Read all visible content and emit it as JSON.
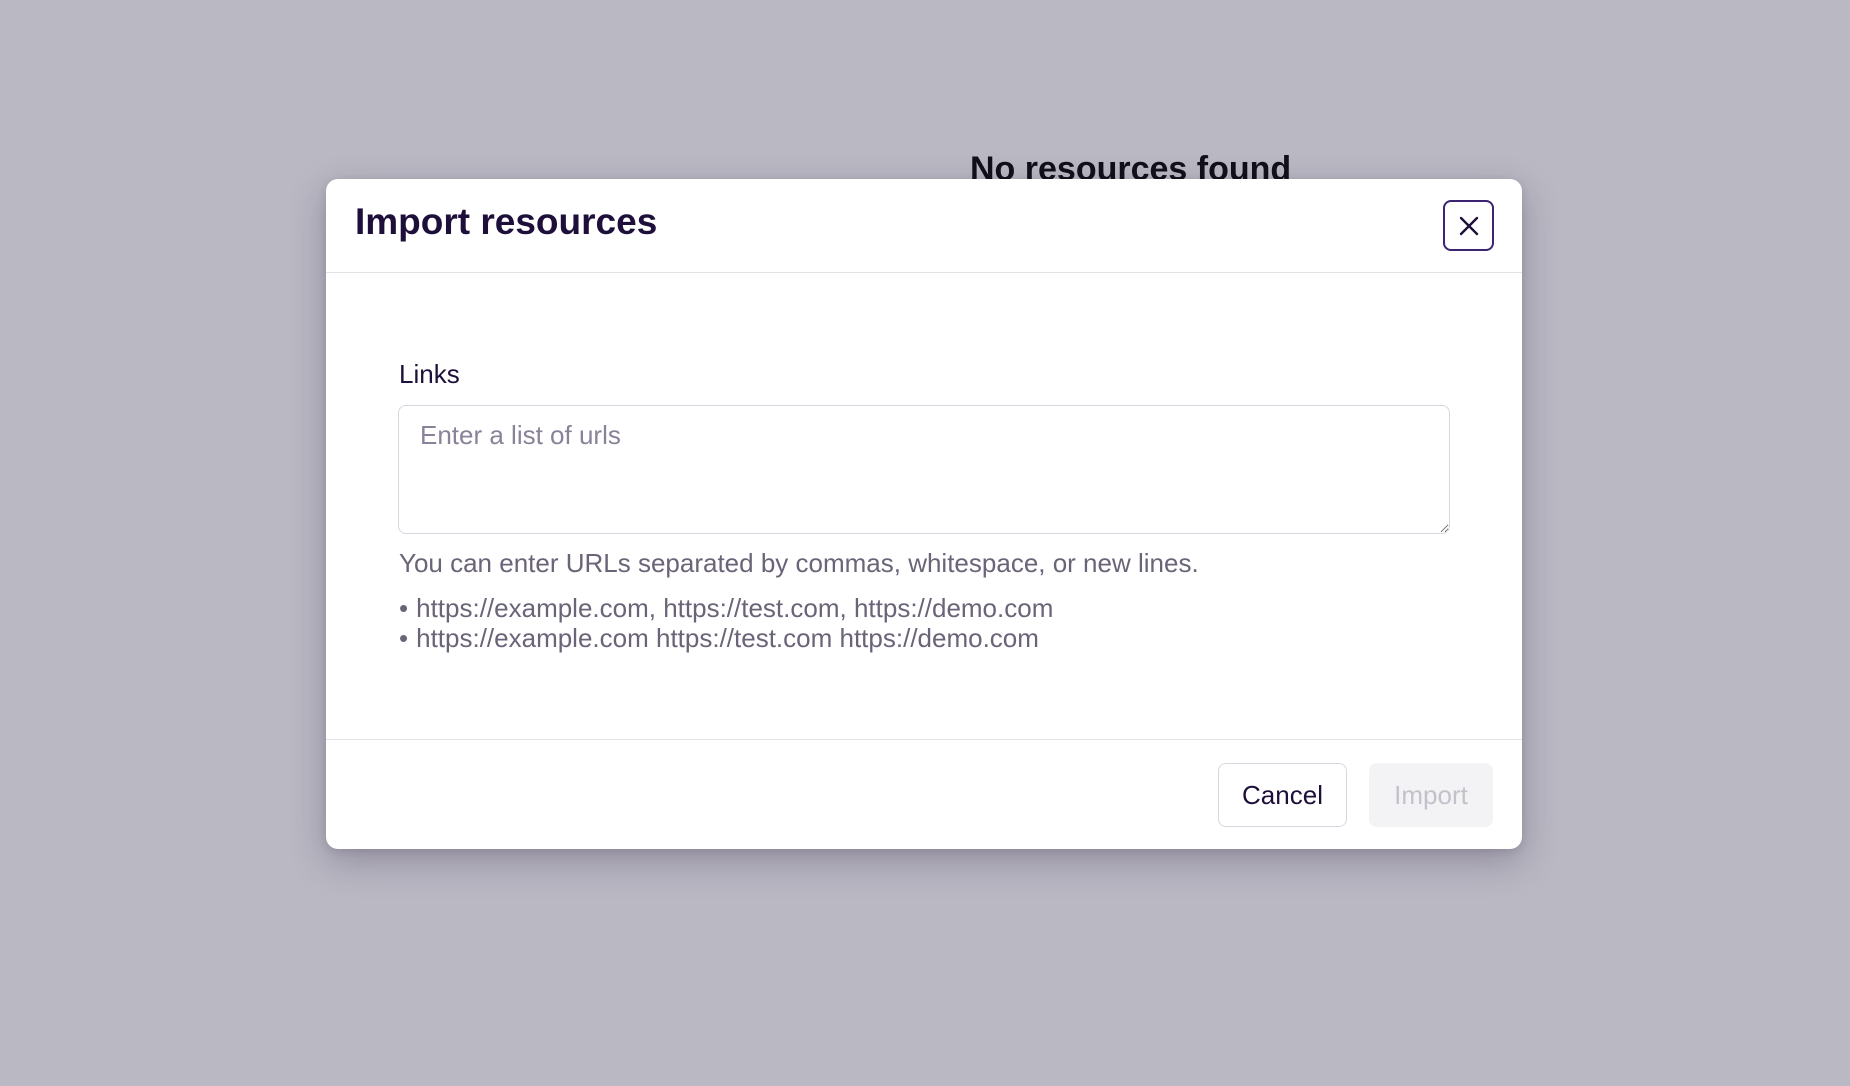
{
  "background": {
    "empty_state_title": "No resources found"
  },
  "modal": {
    "title": "Import resources",
    "close_icon": "close-icon",
    "links_label": "Links",
    "links_value": "",
    "links_placeholder": "Enter a list of urls",
    "help_text": "You can enter URLs separated by commas, whitespace, or new lines.",
    "examples": [
      "https://example.com, https://test.com, https://demo.com",
      "https://example.com https://test.com https://demo.com"
    ],
    "bullet": "•",
    "cancel_label": "Cancel",
    "import_label": "Import",
    "import_enabled": false
  },
  "colors": {
    "overlay": "#bab8c3",
    "primary_text": "#1d0f3a",
    "muted_text": "#6b6478",
    "close_border": "#3c2470",
    "disabled_button_bg": "#f3f3f5",
    "disabled_button_text": "#c4c1cb"
  }
}
